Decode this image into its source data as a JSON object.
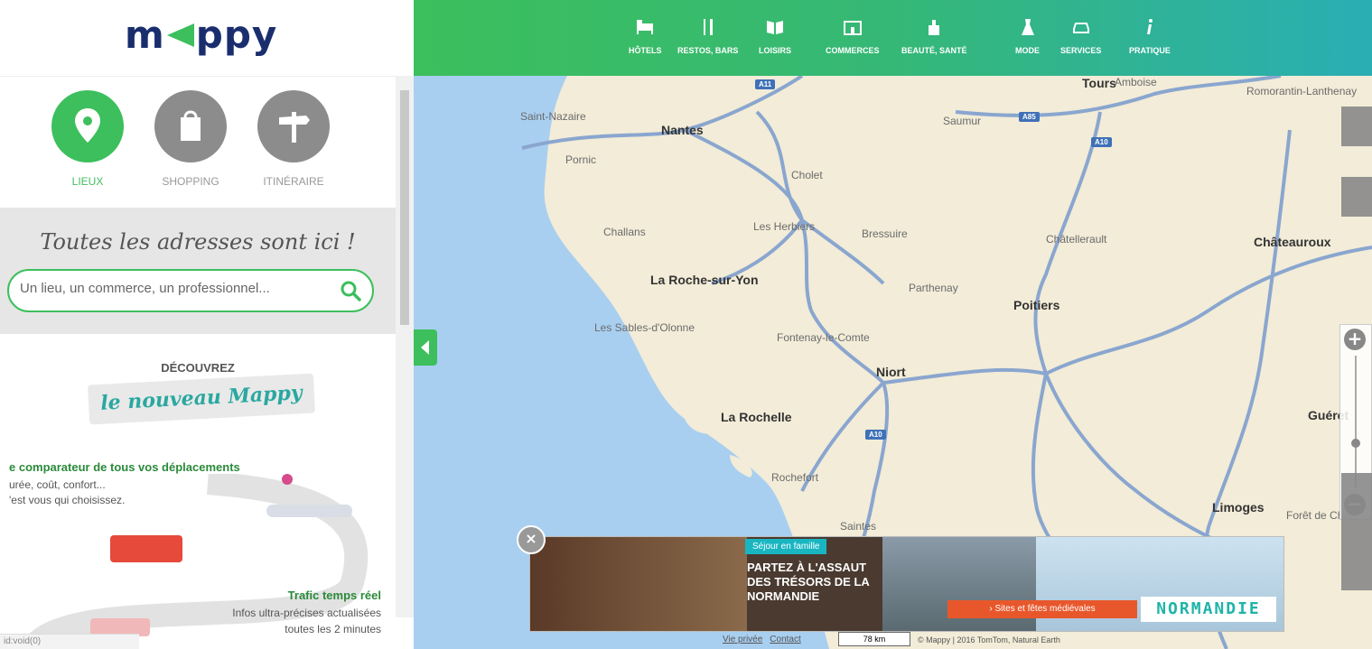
{
  "brand": {
    "logo_left": "m",
    "logo_right": "ppy"
  },
  "modes": [
    {
      "label": "LIEUX",
      "icon": "location-pin-icon",
      "active": true
    },
    {
      "label": "SHOPPING",
      "icon": "shopping-bag-icon",
      "active": false
    },
    {
      "label": "ITINÉRAIRE",
      "icon": "signpost-icon",
      "active": false
    }
  ],
  "search": {
    "tagline": "Toutes les adresses sont ici !",
    "placeholder": "Un lieu, un commerce, un professionnel..."
  },
  "promo": {
    "kicker": "DÉCOUVREZ",
    "headline": "le nouveau Mappy",
    "feature1_title": "e comparateur de tous vos déplacements",
    "feature1_line1": "urée, coût, confort...",
    "feature1_line2": "'est vous qui choisissez.",
    "feature2_title": "Trafic temps réel",
    "feature2_line1": "Infos ultra-précises actualisées",
    "feature2_line2": "toutes les 2 minutes"
  },
  "statusbar": "id:void(0)",
  "nav": {
    "items": [
      {
        "label": "HÔTELS",
        "icon": "bed-icon"
      },
      {
        "label": "RESTOS, BARS",
        "icon": "cutlery-icon"
      },
      {
        "label": "LOISIRS",
        "icon": "book-icon"
      },
      {
        "label": "COMMERCES",
        "icon": "shop-icon"
      },
      {
        "label": "BEAUTÉ, SANTÉ",
        "icon": "perfume-icon"
      },
      {
        "label": "MODE",
        "icon": "dress-icon"
      },
      {
        "label": "SERVICES",
        "icon": "car-service-icon"
      },
      {
        "label": "PRATIQUE",
        "icon": "info-icon"
      }
    ]
  },
  "map": {
    "cities": [
      {
        "name": "Saint-Nazaire",
        "big": false
      },
      {
        "name": "Nantes",
        "big": true
      },
      {
        "name": "Pornic",
        "big": false
      },
      {
        "name": "Cholet",
        "big": false
      },
      {
        "name": "Challans",
        "big": false
      },
      {
        "name": "Les Herbiers",
        "big": false
      },
      {
        "name": "Bressuire",
        "big": false
      },
      {
        "name": "La Roche-sur-Yon",
        "big": true
      },
      {
        "name": "Parthenay",
        "big": false
      },
      {
        "name": "Les Sables-d'Olonne",
        "big": false
      },
      {
        "name": "Fontenay-le-Comte",
        "big": false
      },
      {
        "name": "Niort",
        "big": true
      },
      {
        "name": "La Rochelle",
        "big": true
      },
      {
        "name": "Rochefort",
        "big": false
      },
      {
        "name": "Saintes",
        "big": false
      },
      {
        "name": "Poitiers",
        "big": true
      },
      {
        "name": "Châtellerault",
        "big": false
      },
      {
        "name": "Saumur",
        "big": false
      },
      {
        "name": "Tours",
        "big": true
      },
      {
        "name": "Amboise",
        "big": false
      },
      {
        "name": "Romorantin-Lanthenay",
        "big": false
      },
      {
        "name": "Châteauroux",
        "big": true
      },
      {
        "name": "Guéret",
        "big": true
      },
      {
        "name": "Limoges",
        "big": true
      },
      {
        "name": "Forêt de Chateauneuf",
        "big": false
      }
    ],
    "shields": [
      "A11",
      "A85",
      "A10",
      "A10"
    ],
    "footer_links": [
      "Vie privée",
      "Contact"
    ],
    "scale": "78 km",
    "copyright": "© Mappy | 2016 TomTom, Natural Earth"
  },
  "ad": {
    "close": "×",
    "tag": "Séjour en famille",
    "headline": "PARTEZ À L'ASSAUT DES TRÉSORS DE LA NORMANDIE",
    "button": "› Sites et fêtes médiévales",
    "brand": "NORMANDIE"
  },
  "colors": {
    "brand_green": "#3cbf5c",
    "brand_navy": "#1a2e6e",
    "water": "#a9cff0",
    "land": "#f2ecd8",
    "road": "#8aa6cf"
  }
}
